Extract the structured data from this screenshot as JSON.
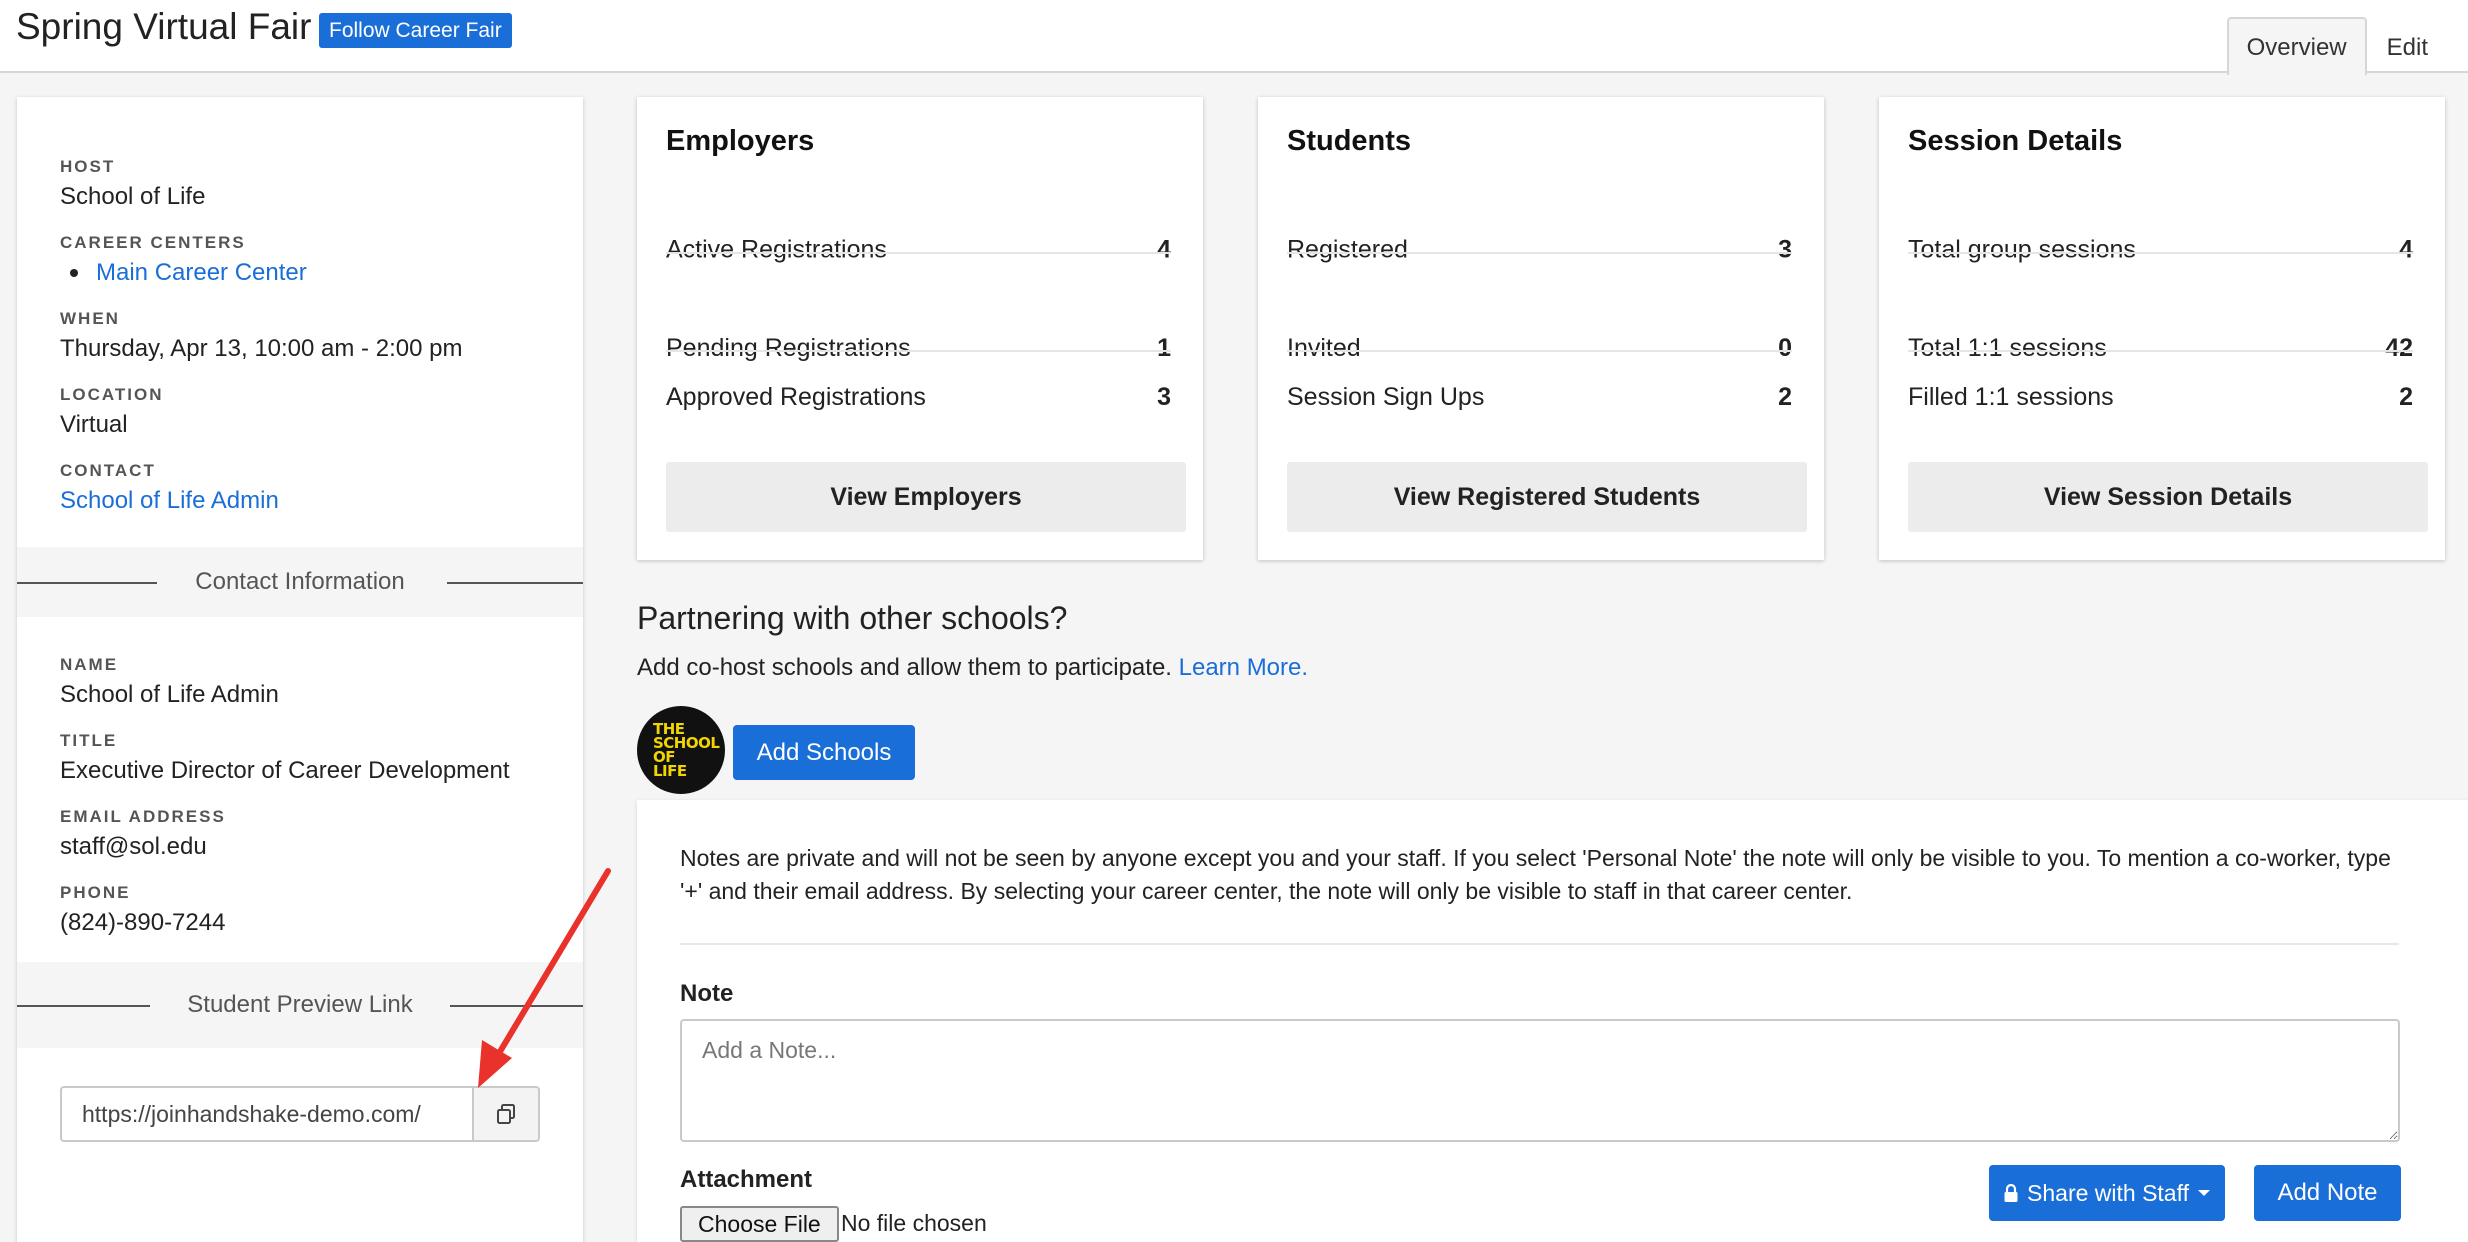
{
  "header": {
    "title": "Spring Virtual Fair",
    "follow_label": "Follow Career Fair",
    "tabs": [
      {
        "label": "Overview",
        "active": true
      },
      {
        "label": "Edit",
        "active": false
      }
    ]
  },
  "sidebar": {
    "host_label": "HOST",
    "host_value": "School of Life",
    "career_centers_label": "CAREER CENTERS",
    "career_centers": [
      "Main Career Center"
    ],
    "when_label": "WHEN",
    "when_value": "Thursday, Apr 13, 10:00 am - 2:00 pm",
    "location_label": "LOCATION",
    "location_value": "Virtual",
    "contact_label": "CONTACT",
    "contact_value": "School of Life Admin",
    "contact_info_heading": "Contact Information",
    "name_label": "NAME",
    "name_value": "School of Life Admin",
    "title_label": "TITLE",
    "title_value": "Executive Director of Career Development",
    "email_label": "EMAIL ADDRESS",
    "email_value": "staff@sol.edu",
    "phone_label": "PHONE",
    "phone_value": "(824)-890-7244",
    "preview_heading": "Student Preview Link",
    "preview_url": "https://joinhandshake-demo.com/"
  },
  "cards": {
    "employers": {
      "title": "Employers",
      "rows": [
        {
          "label": "Active Registrations",
          "value": "4"
        },
        {
          "label": "Pending Registrations",
          "value": "1"
        },
        {
          "label": "Approved Registrations",
          "value": "3"
        }
      ],
      "button": "View Employers"
    },
    "students": {
      "title": "Students",
      "rows": [
        {
          "label": "Registered",
          "value": "3"
        },
        {
          "label": "Invited",
          "value": "0"
        },
        {
          "label": "Session Sign Ups",
          "value": "2"
        }
      ],
      "button": "View Registered Students"
    },
    "sessions": {
      "title": "Session Details",
      "rows": [
        {
          "label": "Total group sessions",
          "value": "4"
        },
        {
          "label": "Total 1:1 sessions",
          "value": "42"
        },
        {
          "label": "Filled 1:1 sessions",
          "value": "2"
        }
      ],
      "button": "View Session Details"
    }
  },
  "partnering": {
    "title": "Partnering with other schools?",
    "description": "Add co-host schools and allow them to participate.",
    "learn_more": "Learn More.",
    "logo_lines": [
      "THE",
      "SCHOOL",
      "OF LIFE"
    ],
    "add_schools": "Add Schools"
  },
  "notes": {
    "description": "Notes are private and will not be seen by anyone except you and your staff. If you select 'Personal Note' the note will only be visible to you. To mention a co-worker, type '+' and their email address. By selecting your career center, the note will only be visible to staff in that career center.",
    "note_label": "Note",
    "note_placeholder": "Add a Note...",
    "attachment_label": "Attachment",
    "choose_file": "Choose File",
    "file_status": "No file chosen",
    "share_label": "Share with Staff",
    "add_note_label": "Add Note"
  },
  "colors": {
    "accent": "#1a6ed8",
    "annotation_arrow": "#e8322b"
  }
}
